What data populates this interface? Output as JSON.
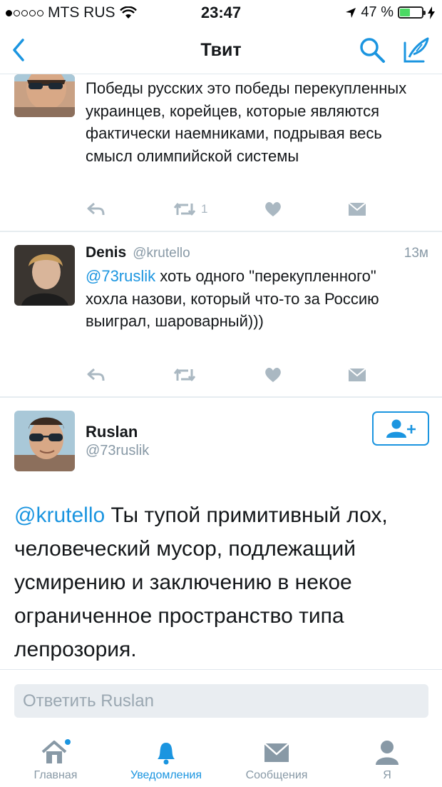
{
  "status_bar": {
    "carrier": "MTS RUS",
    "time": "23:47",
    "battery": "47 %",
    "battery_level": 0.47
  },
  "nav": {
    "title": "Твит"
  },
  "tweets": [
    {
      "text": "Победы русских это победы перекупленных украинцев, корейцев, которые являются фактически наемниками, подрывая весь смысл олимпийской системы",
      "retweets": "1"
    },
    {
      "name": "Denis",
      "handle": "@krutello",
      "time": "13м",
      "mention": "@73ruslik",
      "text": " хоть одного \"перекупленного\" хохла назови, который что-то за Россию выиграл, шароварный)))"
    }
  ],
  "main_tweet": {
    "name": "Ruslan",
    "handle": "@73ruslik",
    "mention": "@krutello",
    "text": " Ты тупой примитивный лох, человеческий мусор, подлежащий усмирению и заключению в некое ограниченное пространство типа лепрозория."
  },
  "reply": {
    "placeholder": "Ответить Ruslan"
  },
  "tabs": [
    {
      "label": "Главная",
      "icon": "home-icon"
    },
    {
      "label": "Уведомления",
      "icon": "bell-icon",
      "active": true
    },
    {
      "label": "Сообщения",
      "icon": "envelope-icon"
    },
    {
      "label": "Я",
      "icon": "person-icon"
    }
  ],
  "colors": {
    "accent": "#1b95e0",
    "muted": "#aab8c2",
    "battery": "#4cd964"
  }
}
